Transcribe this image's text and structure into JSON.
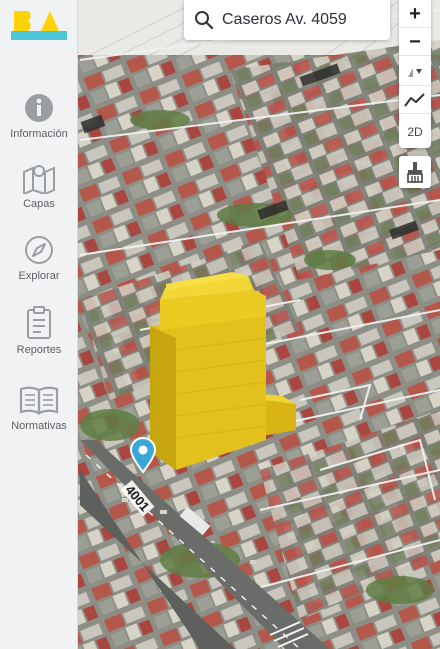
{
  "sidebar": {
    "logo_text": "BA",
    "items": [
      {
        "label": "Información",
        "icon": "info-icon"
      },
      {
        "label": "Capas",
        "icon": "map-layers-icon"
      },
      {
        "label": "Explorar",
        "icon": "compass-icon"
      },
      {
        "label": "Reportes",
        "icon": "clipboard-icon"
      },
      {
        "label": "Normativas",
        "icon": "book-icon"
      }
    ]
  },
  "search": {
    "value": "Caseros Av. 4059",
    "icon": "search-icon"
  },
  "toolbar": {
    "zoom_in": "+",
    "zoom_out": "−",
    "view_mode": "2D",
    "buttons": [
      "zoom-in",
      "zoom-out",
      "rotate",
      "elevation-profile",
      "2d-toggle",
      "paint-brush"
    ]
  },
  "map": {
    "pin_label": "4001"
  },
  "colors": {
    "brand_yellow": "#fdd306",
    "brand_cyan": "#4dc6d8",
    "building_yellow": "#e6c21a",
    "pin_blue": "#3ba7d9"
  }
}
